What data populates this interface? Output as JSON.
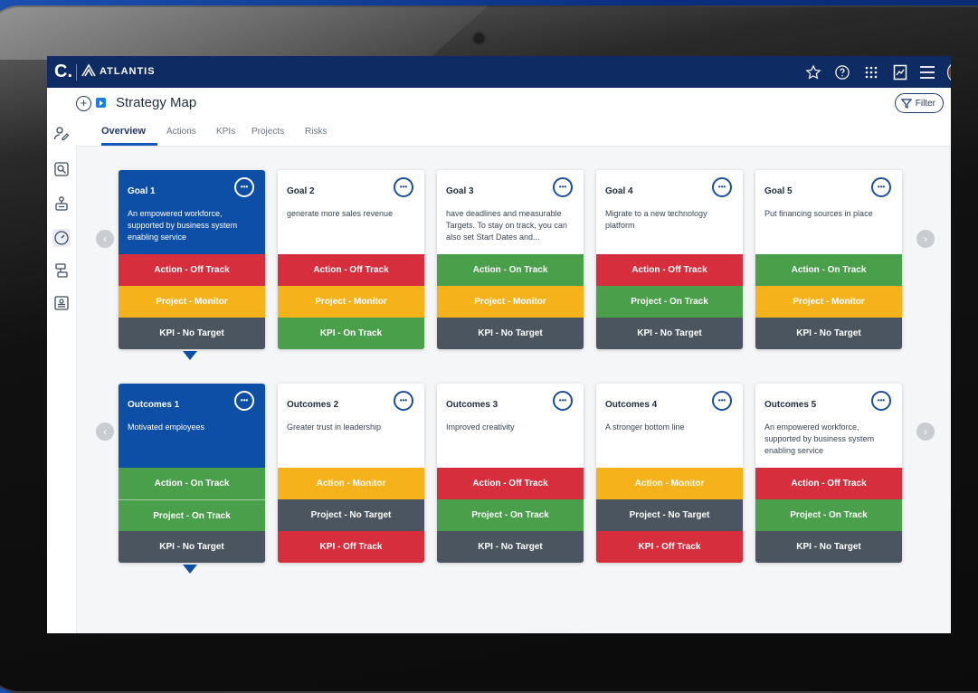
{
  "app": {
    "brand_letter": "C.",
    "org_name": "ATLANTIS",
    "page_title": "Strategy Map",
    "filter_label": "Filter"
  },
  "topbar_icons": [
    "star-icon",
    "help-icon",
    "apps-grid-icon",
    "report-icon",
    "menu-icon",
    "avatar"
  ],
  "sidebar_icons": [
    "users-icon",
    "search-person-icon",
    "org-icon",
    "dashboard-icon",
    "flow-icon",
    "id-card-icon"
  ],
  "tabs": [
    {
      "label": "Overview",
      "active": true
    },
    {
      "label": "Actions",
      "active": false
    },
    {
      "label": "KPIs",
      "active": false
    },
    {
      "label": "Projects",
      "active": false
    },
    {
      "label": "Risks",
      "active": false
    }
  ],
  "colors": {
    "off_track": "#d62e3c",
    "monitor": "#f6b21a",
    "on_track": "#4a9f4b",
    "no_target": "#4b5560",
    "selected": "#0d4ea6"
  },
  "goals": [
    {
      "title": "Goal 1",
      "desc": "An empowered workforce, supported by business system enabling service",
      "statuses": [
        {
          "label": "Action - Off Track",
          "state": "off_track"
        },
        {
          "label": "Project - Monitor",
          "state": "monitor"
        },
        {
          "label": "KPI - No Target",
          "state": "no_target"
        }
      ]
    },
    {
      "title": "Goal 2",
      "desc": "generate more sales revenue",
      "statuses": [
        {
          "label": "Action - Off Track",
          "state": "off_track"
        },
        {
          "label": "Project - Monitor",
          "state": "monitor"
        },
        {
          "label": "KPI - On Track",
          "state": "on_track"
        }
      ]
    },
    {
      "title": "Goal 3",
      "desc": "have deadlines and measurable Targets. To stay on track, you can also set Start Dates and...",
      "statuses": [
        {
          "label": "Action - On Track",
          "state": "on_track"
        },
        {
          "label": "Project - Monitor",
          "state": "monitor"
        },
        {
          "label": "KPI - No Target",
          "state": "no_target"
        }
      ]
    },
    {
      "title": "Goal 4",
      "desc": "Migrate to a new technology platform",
      "statuses": [
        {
          "label": "Action - Off Track",
          "state": "off_track"
        },
        {
          "label": "Project  - On Track",
          "state": "on_track"
        },
        {
          "label": "KPI - No Target",
          "state": "no_target"
        }
      ]
    },
    {
      "title": "Goal 5",
      "desc": "Put financing sources in place",
      "statuses": [
        {
          "label": "Action - On Track",
          "state": "on_track"
        },
        {
          "label": "Project - Monitor",
          "state": "monitor"
        },
        {
          "label": "KPI - No Target",
          "state": "no_target"
        }
      ]
    }
  ],
  "outcomes": [
    {
      "title": "Outcomes 1",
      "desc": "Motivated employees",
      "statuses": [
        {
          "label": "Action - On Track",
          "state": "on_track"
        },
        {
          "label": "Project - On Track",
          "state": "on_track"
        },
        {
          "label": "KPI - No Target",
          "state": "no_target"
        }
      ]
    },
    {
      "title": "Outcomes 2",
      "desc": "Greater trust in leadership",
      "statuses": [
        {
          "label": "Action - Monitor",
          "state": "monitor"
        },
        {
          "label": "Project - No Target",
          "state": "no_target"
        },
        {
          "label": "KPI - Off Track",
          "state": "off_track"
        }
      ]
    },
    {
      "title": "Outcomes 3",
      "desc": "Improved creativity",
      "statuses": [
        {
          "label": "Action - Off Track",
          "state": "off_track"
        },
        {
          "label": "Project - On Track",
          "state": "on_track"
        },
        {
          "label": "KPI - No Target",
          "state": "no_target"
        }
      ]
    },
    {
      "title": "Outcomes 4",
      "desc": "A stronger bottom line",
      "statuses": [
        {
          "label": "Action - Monitor",
          "state": "monitor"
        },
        {
          "label": "Project - No Target",
          "state": "no_target"
        },
        {
          "label": "KPI - Off Track",
          "state": "off_track"
        }
      ]
    },
    {
      "title": "Outcomes 5",
      "desc": "An empowered workforce, supported by business system enabling service",
      "statuses": [
        {
          "label": "Action - Off Track",
          "state": "off_track"
        },
        {
          "label": "Project  - On Track",
          "state": "on_track"
        },
        {
          "label": "KPI - No Target",
          "state": "no_target"
        }
      ]
    }
  ]
}
